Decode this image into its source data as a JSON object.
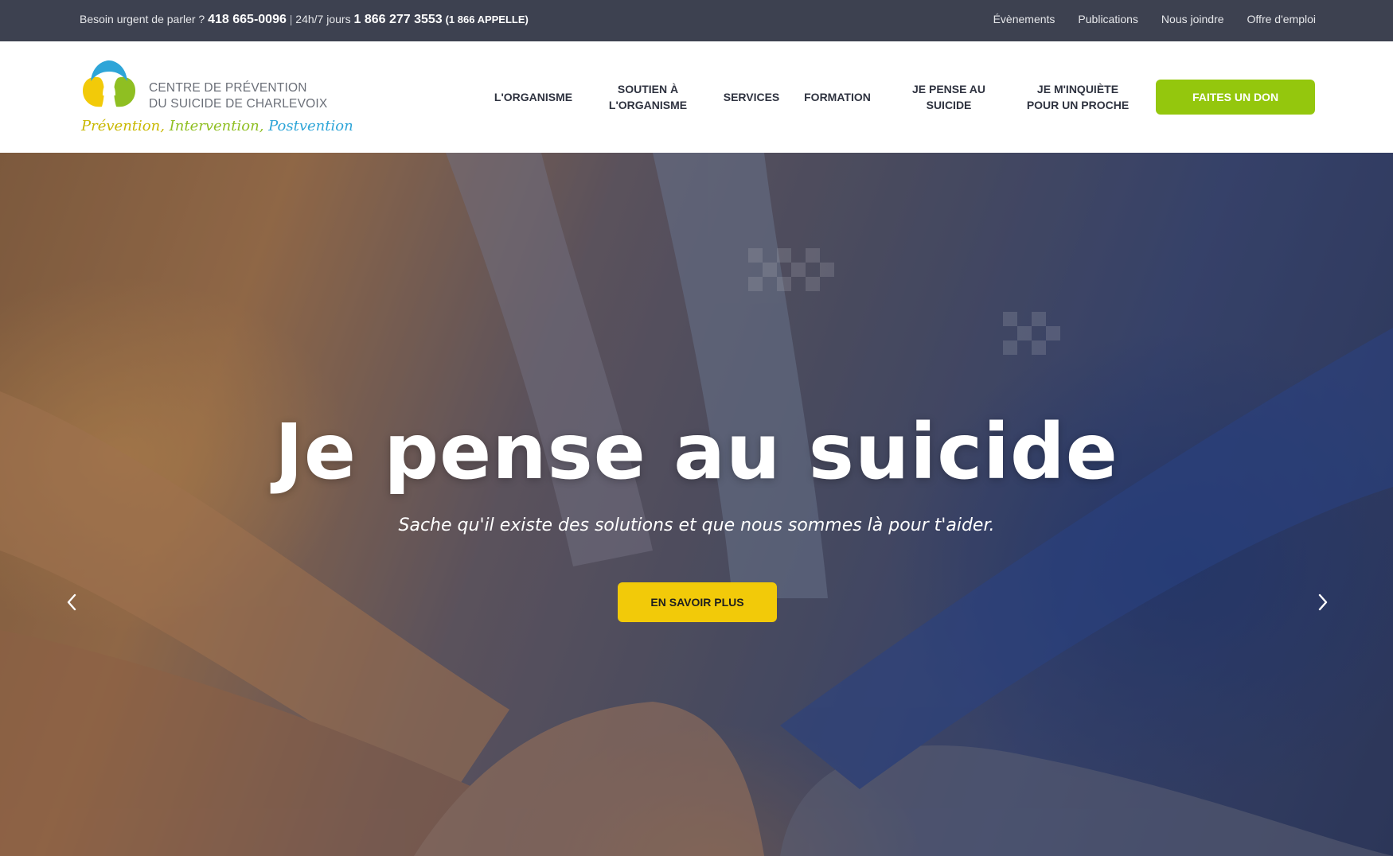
{
  "topbar": {
    "urgent_label": "Besoin urgent de parler ?",
    "phone_local": "418 665-0096",
    "separator": "|",
    "availability": "24h/7 jours",
    "phone_toll_free": "1 866 277 3553",
    "phone_toll_free_alt": "(1 866 APPELLE)",
    "links": [
      "Évènements",
      "Publications",
      "Nous joindre",
      "Offre d'emploi"
    ]
  },
  "logo": {
    "line1": "CENTRE DE PRÉVENTION",
    "line2": "DU SUICIDE DE CHARLEVOIX",
    "tagline_1": "Prévention",
    "tagline_sep": ",",
    "tagline_2": "Intervention",
    "tagline_3": "Postvention",
    "colors": {
      "blue": "#2ea5d8",
      "yellow": "#f2ca09",
      "green": "#8fbf22"
    }
  },
  "nav": {
    "items": [
      "L'ORGANISME",
      "SOUTIEN À\nL'ORGANISME",
      "SERVICES",
      "FORMATION",
      "JE PENSE AU\nSUICIDE",
      "JE M'INQUIÈTE\nPOUR UN PROCHE"
    ],
    "donate_label": "FAITES UN DON"
  },
  "hero": {
    "title": "Je pense au suicide",
    "subtitle": "Sache qu'il existe des solutions et que nous sommes là pour t'aider.",
    "cta_label": "EN SAVOIR PLUS",
    "prev_icon": "chevron-left-icon",
    "next_icon": "chevron-right-icon"
  },
  "colors": {
    "topbar_bg": "#3d4150",
    "donate_bg": "#94c70d",
    "cta_bg": "#f2ca09"
  }
}
